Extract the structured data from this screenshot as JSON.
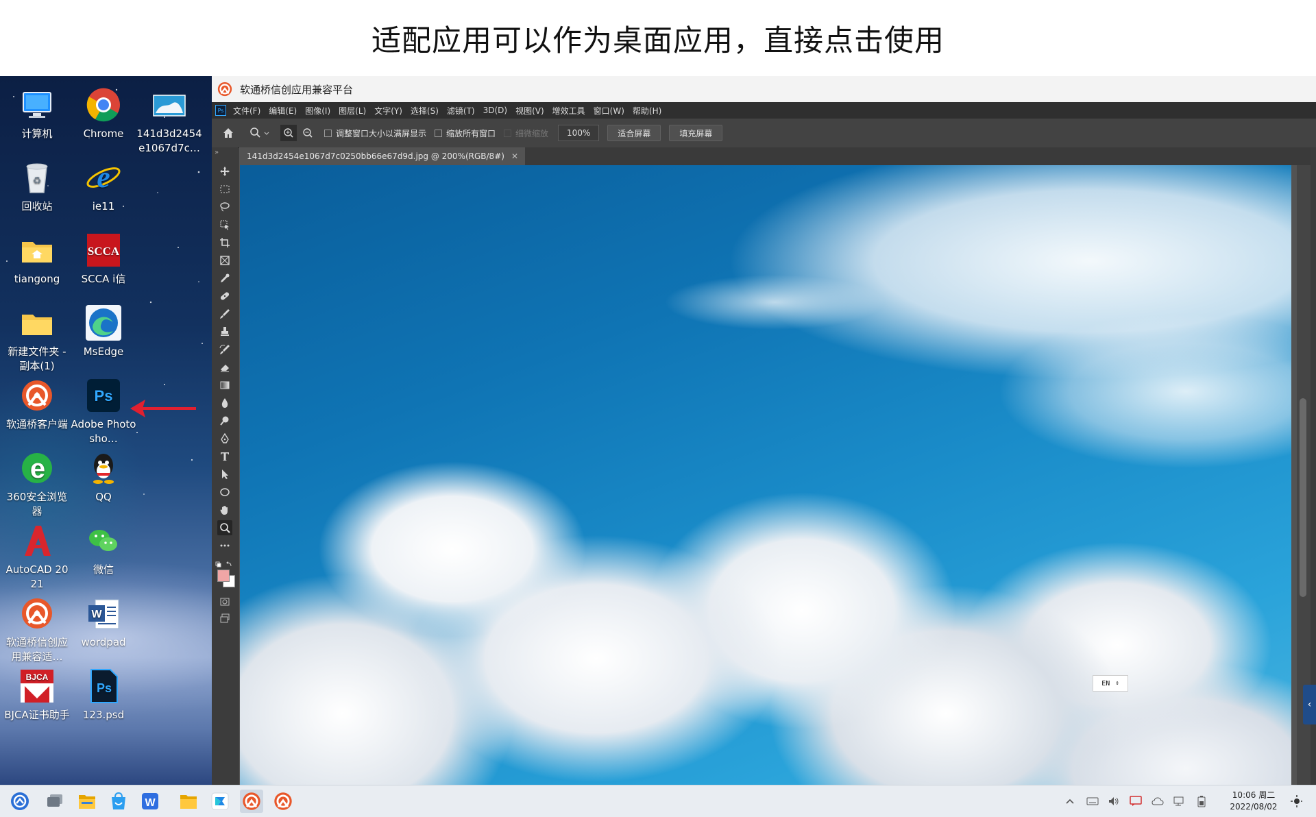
{
  "caption": "适配应用可以作为桌面应用，直接点击使用",
  "desktop": {
    "icons": [
      {
        "label": "计算机",
        "icon": "computer-icon"
      },
      {
        "label": "Chrome",
        "icon": "chrome-icon"
      },
      {
        "label": "141d3d2454 e1067d7c…",
        "icon": "image-file-icon"
      },
      {
        "label": "回收站",
        "icon": "recycle-bin-icon"
      },
      {
        "label": "ie11",
        "icon": "ie-icon"
      },
      {
        "label": "tiangong",
        "icon": "folder-icon"
      },
      {
        "label": "SCCA i信",
        "icon": "scca-icon",
        "logo_text": "SCCA"
      },
      {
        "label": "新建文件夹 - 副本(1)",
        "icon": "folder-icon"
      },
      {
        "label": "MsEdge",
        "icon": "edge-icon"
      },
      {
        "label": "软通桥客户端",
        "icon": "isoftstone-icon"
      },
      {
        "label": "Adobe Photosho…",
        "icon": "photoshop-icon",
        "logo_text": "Ps"
      },
      {
        "label": "360安全浏览器",
        "icon": "browser-360-icon"
      },
      {
        "label": "QQ",
        "icon": "qq-icon"
      },
      {
        "label": "AutoCAD 2021",
        "icon": "autocad-icon"
      },
      {
        "label": "微信",
        "icon": "wechat-icon"
      },
      {
        "label": "软通桥信创应用兼容适…",
        "icon": "isoftstone-icon"
      },
      {
        "label": "wordpad",
        "icon": "wordpad-icon"
      },
      {
        "label": "BJCA证书助手",
        "icon": "bjca-icon",
        "logo_text": "BJCA"
      },
      {
        "label": "123.psd",
        "icon": "psd-file-icon",
        "logo_text": "Ps"
      }
    ]
  },
  "window": {
    "title": "软通桥信创应用兼容平台",
    "app_badge": "Ps",
    "menu": [
      "文件(F)",
      "编辑(E)",
      "图像(I)",
      "图层(L)",
      "文字(Y)",
      "选择(S)",
      "滤镜(T)",
      "3D(D)",
      "视图(V)",
      "增效工具",
      "窗口(W)",
      "帮助(H)"
    ],
    "options": {
      "resize_windows": "调整窗口大小以满屏显示",
      "zoom_all": "缩放所有窗口",
      "scrubby_zoom": "细微缩放",
      "zoom_value": "100%",
      "fit_screen": "适合屏幕",
      "fill_screen": "填充屏幕"
    },
    "document_tab": "141d3d2454e1067d7c0250bb66e67d9d.jpg @ 200%(RGB/8#)",
    "ime_indicator": "EN",
    "colors": {
      "foreground": "#f0a6a6",
      "background": "#ffffff"
    }
  },
  "taskbar": {
    "time": "10:06 周二",
    "date": "2022/08/02"
  }
}
